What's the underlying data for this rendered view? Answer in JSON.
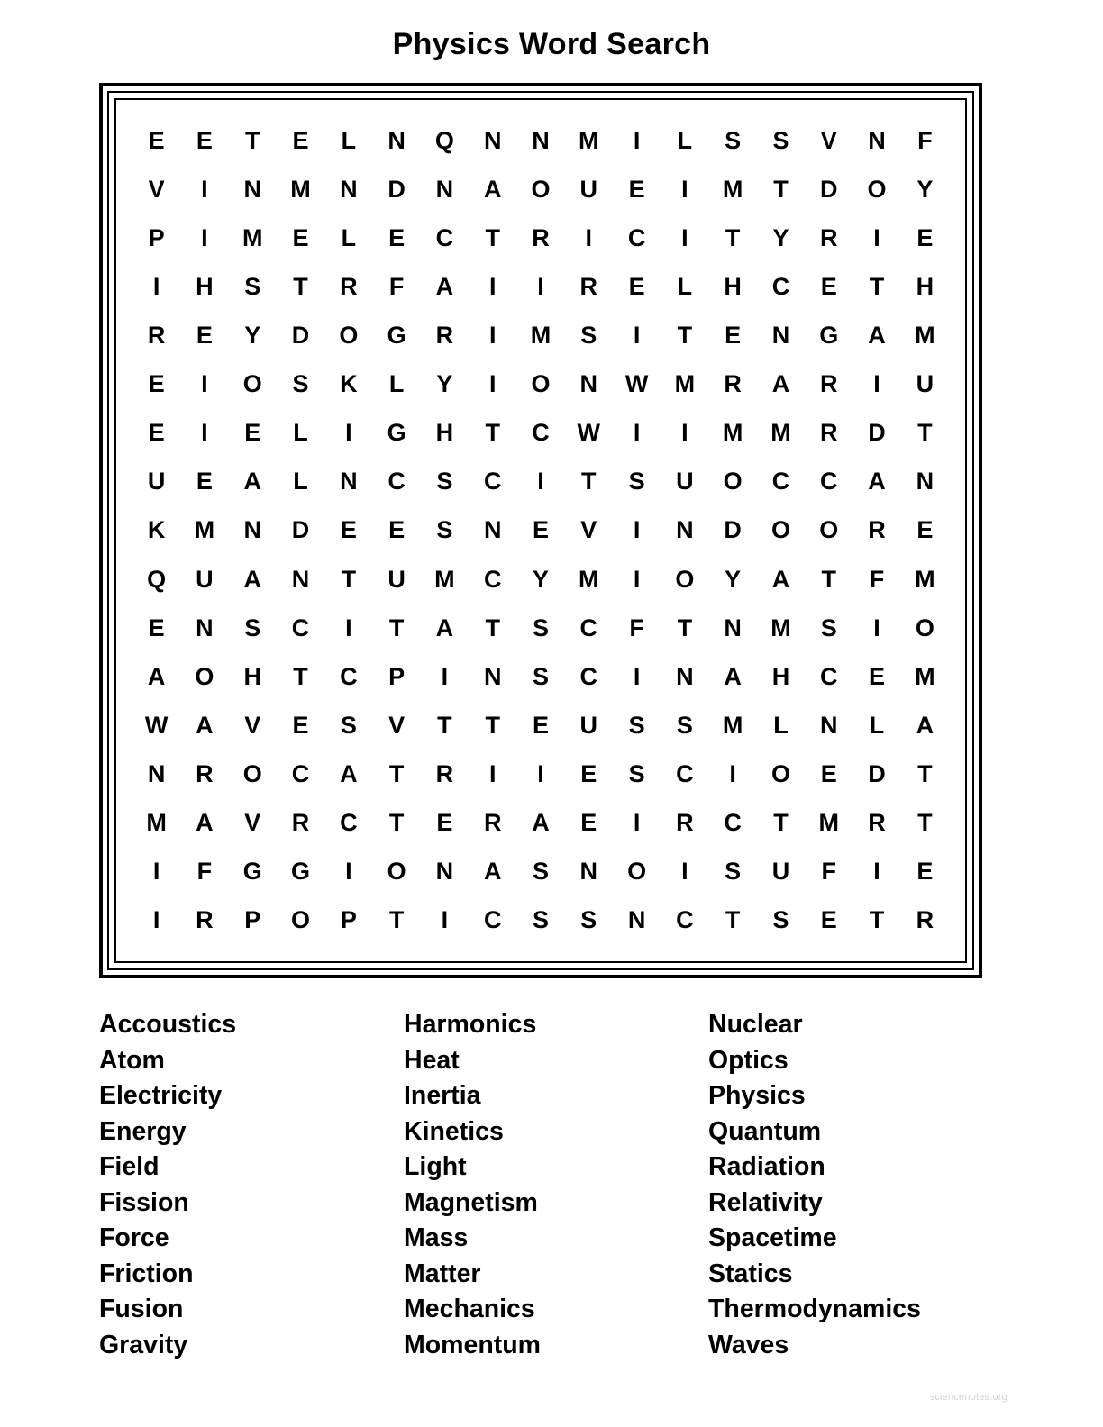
{
  "title": "Physics Word Search",
  "watermark": "sciencenotes.org",
  "grid": {
    "rows": 17,
    "cols": 17,
    "letters": [
      [
        "E",
        "E",
        "T",
        "E",
        "L",
        "N",
        "Q",
        "N",
        "N",
        "M",
        "I",
        "L",
        "S",
        "S",
        "V",
        "N",
        "F"
      ],
      [
        "V",
        "I",
        "N",
        "M",
        "N",
        "D",
        "N",
        "A",
        "O",
        "U",
        "E",
        "I",
        "M",
        "T",
        "D",
        "O",
        "Y"
      ],
      [
        "P",
        "I",
        "M",
        "E",
        "L",
        "E",
        "C",
        "T",
        "R",
        "I",
        "C",
        "I",
        "T",
        "Y",
        "R",
        "I",
        "E"
      ],
      [
        "I",
        "H",
        "S",
        "T",
        "R",
        "F",
        "A",
        "I",
        "I",
        "R",
        "E",
        "L",
        "H",
        "C",
        "E",
        "T",
        "H"
      ],
      [
        "R",
        "E",
        "Y",
        "D",
        "O",
        "G",
        "R",
        "I",
        "M",
        "S",
        "I",
        "T",
        "E",
        "N",
        "G",
        "A",
        "M"
      ],
      [
        "E",
        "I",
        "O",
        "S",
        "K",
        "L",
        "Y",
        "I",
        "O",
        "N",
        "W",
        "M",
        "R",
        "A",
        "R",
        "I",
        "U"
      ],
      [
        "E",
        "I",
        "E",
        "L",
        "I",
        "G",
        "H",
        "T",
        "C",
        "W",
        "I",
        "I",
        "M",
        "M",
        "R",
        "D",
        "T"
      ],
      [
        "U",
        "E",
        "A",
        "L",
        "N",
        "C",
        "S",
        "C",
        "I",
        "T",
        "S",
        "U",
        "O",
        "C",
        "C",
        "A",
        "N"
      ],
      [
        "K",
        "M",
        "N",
        "D",
        "E",
        "E",
        "S",
        "N",
        "E",
        "V",
        "I",
        "N",
        "D",
        "O",
        "O",
        "R",
        "E"
      ],
      [
        "Q",
        "U",
        "A",
        "N",
        "T",
        "U",
        "M",
        "C",
        "Y",
        "M",
        "I",
        "O",
        "Y",
        "A",
        "T",
        "F",
        "M"
      ],
      [
        "E",
        "N",
        "S",
        "C",
        "I",
        "T",
        "A",
        "T",
        "S",
        "C",
        "F",
        "T",
        "N",
        "M",
        "S",
        "I",
        "O"
      ],
      [
        "A",
        "O",
        "H",
        "T",
        "C",
        "P",
        "I",
        "N",
        "S",
        "C",
        "I",
        "N",
        "A",
        "H",
        "C",
        "E",
        "M"
      ],
      [
        "W",
        "A",
        "V",
        "E",
        "S",
        "V",
        "T",
        "T",
        "E",
        "U",
        "S",
        "S",
        "M",
        "L",
        "N",
        "L",
        "A"
      ],
      [
        "N",
        "R",
        "O",
        "C",
        "A",
        "T",
        "R",
        "I",
        "I",
        "E",
        "S",
        "C",
        "I",
        "O",
        "E",
        "D",
        "T"
      ],
      [
        "M",
        "A",
        "V",
        "R",
        "C",
        "T",
        "E",
        "R",
        "A",
        "E",
        "I",
        "R",
        "C",
        "T",
        "M",
        "R",
        "T"
      ],
      [
        "I",
        "F",
        "G",
        "G",
        "I",
        "O",
        "N",
        "A",
        "S",
        "N",
        "O",
        "I",
        "S",
        "U",
        "F",
        "I",
        "E"
      ],
      [
        "I",
        "R",
        "P",
        "O",
        "P",
        "T",
        "I",
        "C",
        "S",
        "S",
        "N",
        "C",
        "T",
        "S",
        "E",
        "T",
        "R"
      ]
    ]
  },
  "word_list": {
    "columns": [
      {
        "words": [
          "Accoustics",
          "Atom",
          "Electricity",
          "Energy",
          "Field",
          "Fission",
          "Force",
          "Friction",
          "Fusion",
          "Gravity"
        ]
      },
      {
        "words": [
          "Harmonics",
          "Heat",
          "Inertia",
          "Kinetics",
          "Light",
          "Magnetism",
          "Mass",
          "Matter",
          "Mechanics",
          "Momentum"
        ]
      },
      {
        "words": [
          "Nuclear",
          "Optics",
          "Physics",
          "Quantum",
          "Radiation",
          "Relativity",
          "Spacetime",
          "Statics",
          "Thermodynamics",
          "Waves"
        ]
      }
    ]
  }
}
